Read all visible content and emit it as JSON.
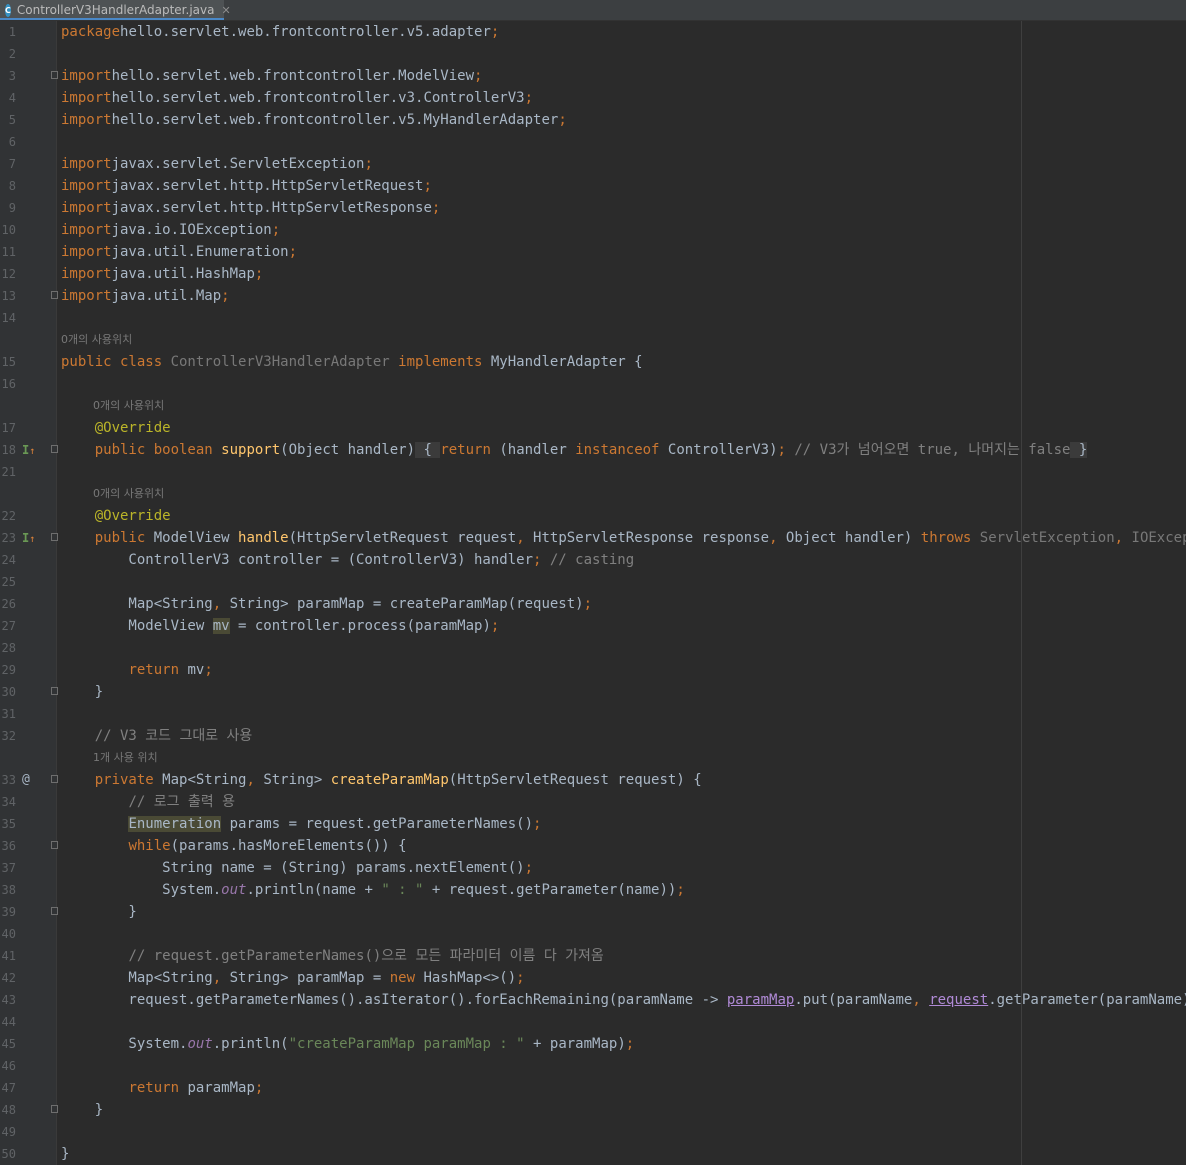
{
  "tab": {
    "file_name": "ControllerV3HandlerAdapter.java",
    "icon": "C",
    "close": "✕"
  },
  "hints": {
    "usages_zero": "0개의 사용위치",
    "usages_one": "1개 사용 위치"
  },
  "lines": [
    {
      "num": "1",
      "segs": [
        [
          "kw",
          "package"
        ],
        [
          "",
          "hello.servlet.web.frontcontroller.v5.adapter"
        ],
        [
          "kw",
          ";"
        ]
      ]
    },
    {
      "num": "2",
      "segs": []
    },
    {
      "num": "3",
      "fold": true,
      "segs": [
        [
          "kw",
          "import"
        ],
        [
          "",
          "hello.servlet.web.frontcontroller.ModelView"
        ],
        [
          "kw",
          ";"
        ]
      ]
    },
    {
      "num": "4",
      "segs": [
        [
          "kw",
          "import"
        ],
        [
          "",
          "hello.servlet.web.frontcontroller.v3.ControllerV3"
        ],
        [
          "kw",
          ";"
        ]
      ]
    },
    {
      "num": "5",
      "segs": [
        [
          "kw",
          "import"
        ],
        [
          "",
          "hello.servlet.web.frontcontroller.v5.MyHandlerAdapter"
        ],
        [
          "kw",
          ";"
        ]
      ]
    },
    {
      "num": "6",
      "segs": []
    },
    {
      "num": "7",
      "segs": [
        [
          "kw",
          "import"
        ],
        [
          "",
          "javax.servlet.ServletException"
        ],
        [
          "kw",
          ";"
        ]
      ]
    },
    {
      "num": "8",
      "segs": [
        [
          "kw",
          "import"
        ],
        [
          "",
          "javax.servlet.http.HttpServletRequest"
        ],
        [
          "kw",
          ";"
        ]
      ]
    },
    {
      "num": "9",
      "segs": [
        [
          "kw",
          "import"
        ],
        [
          "",
          "javax.servlet.http.HttpServletResponse"
        ],
        [
          "kw",
          ";"
        ]
      ]
    },
    {
      "num": "10",
      "segs": [
        [
          "kw",
          "import"
        ],
        [
          "",
          "java.io.IOException"
        ],
        [
          "kw",
          ";"
        ]
      ]
    },
    {
      "num": "11",
      "segs": [
        [
          "kw",
          "import"
        ],
        [
          "",
          "java.util.Enumeration"
        ],
        [
          "kw",
          ";"
        ]
      ]
    },
    {
      "num": "12",
      "segs": [
        [
          "kw",
          "import"
        ],
        [
          "",
          "java.util.HashMap"
        ],
        [
          "kw",
          ";"
        ]
      ]
    },
    {
      "num": "13",
      "fold": true,
      "segs": [
        [
          "kw",
          "import"
        ],
        [
          "",
          "java.util.Map"
        ],
        [
          "kw",
          ";"
        ]
      ]
    },
    {
      "num": "14",
      "segs": []
    },
    {
      "hint": "0개의 사용위치",
      "indent": 0
    },
    {
      "num": "15",
      "segs": [
        [
          "kw",
          "public class "
        ],
        [
          "gr",
          "ControllerV3HandlerAdapter "
        ],
        [
          "kw",
          "implements "
        ],
        [
          "",
          "MyHandlerAdapter {"
        ]
      ]
    },
    {
      "num": "16",
      "segs": []
    },
    {
      "hint": "0개의 사용위치",
      "indent": 1
    },
    {
      "num": "17",
      "segs": [
        [
          "",
          "    "
        ],
        [
          "an",
          "@Override"
        ]
      ]
    },
    {
      "num": "18",
      "icon": "impl",
      "fold": true,
      "segs": [
        [
          "",
          "    "
        ],
        [
          "kw",
          "public boolean "
        ],
        [
          "fn",
          "support"
        ],
        [
          "",
          "(Object handler)"
        ],
        [
          "hlb",
          " { "
        ],
        [
          "kw",
          "return "
        ],
        [
          "",
          "(handler "
        ],
        [
          "kw",
          "instanceof "
        ],
        [
          "",
          "ControllerV3)"
        ],
        [
          "kw",
          "; "
        ],
        [
          "cm",
          "// V3가 넘어오면 true, 나머지는 false"
        ],
        [
          "hlb",
          " }"
        ]
      ]
    },
    {
      "num": "21",
      "segs": []
    },
    {
      "hint": "0개의 사용위치",
      "indent": 1
    },
    {
      "num": "22",
      "segs": [
        [
          "",
          "    "
        ],
        [
          "an",
          "@Override"
        ]
      ]
    },
    {
      "num": "23",
      "icon": "impl",
      "fold": true,
      "segs": [
        [
          "",
          "    "
        ],
        [
          "kw",
          "public "
        ],
        [
          "",
          "ModelView "
        ],
        [
          "fn",
          "handle"
        ],
        [
          "",
          "(HttpServletRequest request"
        ],
        [
          "kw",
          ", "
        ],
        [
          "",
          "HttpServletResponse response"
        ],
        [
          "kw",
          ", "
        ],
        [
          "",
          "Object handler) "
        ],
        [
          "kw",
          "throws "
        ],
        [
          "gr",
          "ServletException"
        ],
        [
          "kw",
          ", "
        ],
        [
          "gr",
          "IOException "
        ],
        [
          "",
          "{"
        ]
      ]
    },
    {
      "num": "24",
      "segs": [
        [
          "",
          "        ControllerV3 controller = (ControllerV3) handler"
        ],
        [
          "kw",
          "; "
        ],
        [
          "cm",
          "// casting"
        ]
      ]
    },
    {
      "num": "25",
      "segs": []
    },
    {
      "num": "26",
      "segs": [
        [
          "",
          "        Map<String"
        ],
        [
          "kw",
          ", "
        ],
        [
          "",
          "String> paramMap = createParamMap(request)"
        ],
        [
          "kw",
          ";"
        ]
      ]
    },
    {
      "num": "27",
      "segs": [
        [
          "",
          "        ModelView "
        ],
        [
          "hl",
          "mv"
        ],
        [
          "",
          " = controller.process(paramMap)"
        ],
        [
          "kw",
          ";"
        ]
      ]
    },
    {
      "num": "28",
      "segs": []
    },
    {
      "num": "29",
      "segs": [
        [
          "",
          "        "
        ],
        [
          "kw",
          "return "
        ],
        [
          "",
          "mv"
        ],
        [
          "kw",
          ";"
        ]
      ]
    },
    {
      "num": "30",
      "fold": true,
      "segs": [
        [
          "",
          "    }"
        ]
      ]
    },
    {
      "num": "31",
      "segs": []
    },
    {
      "num": "32",
      "segs": [
        [
          "",
          "    "
        ],
        [
          "cm",
          "// V3 코드 그대로 사용"
        ]
      ]
    },
    {
      "hint": "1개 사용 위치",
      "indent": 1
    },
    {
      "num": "33",
      "icon": "at",
      "fold": true,
      "segs": [
        [
          "",
          "    "
        ],
        [
          "kw",
          "private "
        ],
        [
          "",
          "Map<String"
        ],
        [
          "kw",
          ", "
        ],
        [
          "",
          "String> "
        ],
        [
          "fn",
          "createParamMap"
        ],
        [
          "",
          "(HttpServletRequest request) {"
        ]
      ]
    },
    {
      "num": "34",
      "segs": [
        [
          "",
          "        "
        ],
        [
          "cm",
          "// 로그 출력 용"
        ]
      ]
    },
    {
      "num": "35",
      "segs": [
        [
          "",
          "        "
        ],
        [
          "hl",
          "Enumeration"
        ],
        [
          "",
          " params = request.getParameterNames()"
        ],
        [
          "kw",
          ";"
        ]
      ]
    },
    {
      "num": "36",
      "fold": true,
      "segs": [
        [
          "",
          "        "
        ],
        [
          "kw",
          "while"
        ],
        [
          "",
          "(params.hasMoreElements()) {"
        ]
      ]
    },
    {
      "num": "37",
      "segs": [
        [
          "",
          "            String name = (String) params.nextElement()"
        ],
        [
          "kw",
          ";"
        ]
      ]
    },
    {
      "num": "38",
      "segs": [
        [
          "",
          "            System."
        ],
        [
          "it",
          "out"
        ],
        [
          "",
          ".println(name + "
        ],
        [
          "st",
          "\" : \""
        ],
        [
          "",
          " + request.getParameter(name))"
        ],
        [
          "kw",
          ";"
        ]
      ]
    },
    {
      "num": "39",
      "fold": true,
      "segs": [
        [
          "",
          "        }"
        ]
      ]
    },
    {
      "num": "40",
      "segs": []
    },
    {
      "num": "41",
      "segs": [
        [
          "",
          "        "
        ],
        [
          "cm",
          "// request.getParameterNames()으로 모든 파라미터 이름 다 가져옴"
        ]
      ]
    },
    {
      "num": "42",
      "segs": [
        [
          "",
          "        Map<String"
        ],
        [
          "kw",
          ", "
        ],
        [
          "",
          "String> paramMap = "
        ],
        [
          "kw",
          "new "
        ],
        [
          "",
          "HashMap<>()"
        ],
        [
          "kw",
          ";"
        ]
      ]
    },
    {
      "num": "43",
      "segs": [
        [
          "",
          "        request.getParameterNames().asIterator().forEachRemaining(paramName -> "
        ],
        [
          "ul",
          "paramMap"
        ],
        [
          "",
          ".put(paramName"
        ],
        [
          "kw",
          ", "
        ],
        [
          "ul",
          "request"
        ],
        [
          "",
          ".getParameter(paramName)))"
        ],
        [
          "kw",
          ";"
        ]
      ]
    },
    {
      "num": "44",
      "segs": []
    },
    {
      "num": "45",
      "segs": [
        [
          "",
          "        System."
        ],
        [
          "it",
          "out"
        ],
        [
          "",
          ".println("
        ],
        [
          "st",
          "\"createParamMap paramMap : \""
        ],
        [
          "",
          " + paramMap)"
        ],
        [
          "kw",
          ";"
        ]
      ]
    },
    {
      "num": "46",
      "segs": []
    },
    {
      "num": "47",
      "segs": [
        [
          "",
          "        "
        ],
        [
          "kw",
          "return "
        ],
        [
          "",
          "paramMap"
        ],
        [
          "kw",
          ";"
        ]
      ]
    },
    {
      "num": "48",
      "fold": true,
      "segs": [
        [
          "",
          "    }"
        ]
      ]
    },
    {
      "num": "49",
      "segs": []
    },
    {
      "num": "50",
      "segs": [
        [
          "",
          "}"
        ]
      ]
    }
  ]
}
